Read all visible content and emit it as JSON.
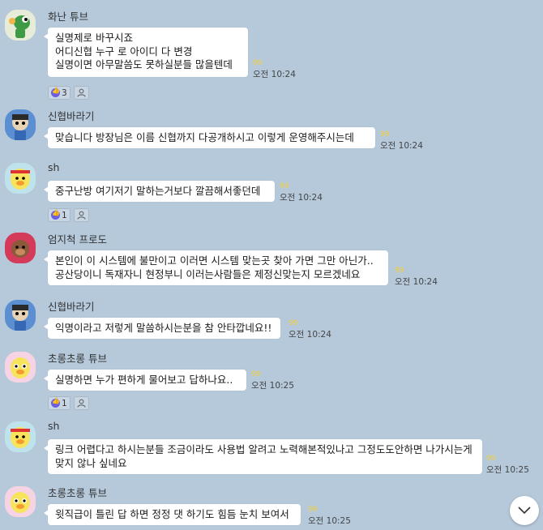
{
  "messages": [
    {
      "name": "화난 튜브",
      "lines": [
        "실명제로 바꾸시죠",
        "어디신협 누구 로 아이디 다 변경",
        "실명이면 아무말씀도 못하실분들 많을텐데"
      ],
      "unread": "99",
      "time": "오전 10:24",
      "reaction_count": "3",
      "avatar": "crocodile-avatar"
    },
    {
      "name": "신협바라기",
      "lines": [
        "맞습니다  방장님은 이름 신협까지 다공개하시고 이렇게 운영해주시는데"
      ],
      "unread": "99",
      "time": "오전 10:24",
      "avatar": "blue-character-avatar"
    },
    {
      "name": "sh",
      "lines": [
        "중구난방 여기저기 말하는거보다 깔끔해서좋던데"
      ],
      "unread": "99",
      "time": "오전 10:24",
      "reaction_count": "1",
      "avatar": "duck-headband-avatar"
    },
    {
      "name": "엄지척 프로도",
      "lines": [
        "본인이 이 시스템에 불만이고 이러면 시스템 맞는곳 찾아 가면 그만 아닌가..",
        "공산당이니 독재자니 현정부니 이러는사람들은 제정신맞는지 모르겠네요"
      ],
      "unread": "99",
      "time": "오전 10:24",
      "avatar": "frodo-dog-avatar"
    },
    {
      "name": "신협바라기",
      "lines": [
        "익명이라고 저렇게 말씀하시는분을 참 안타깝네요!!"
      ],
      "unread": "99",
      "time": "오전 10:24",
      "avatar": "blue-character-avatar"
    },
    {
      "name": "초롱초롱 튜브",
      "lines": [
        "실명하면 누가 편하게 물어보고 답하나요.."
      ],
      "unread": "99",
      "time": "오전 10:25",
      "reaction_count": "1",
      "avatar": "duck-pink-avatar"
    },
    {
      "name": "sh",
      "lines": [
        "링크 어렵다고 하시는분들 조금이라도 사용법 알려고 노력해본적있나고 그정도도안하면 나가시는게 맞지 않나 싶네요"
      ],
      "unread": "99",
      "time": "오전 10:25",
      "avatar": "duck-headband-avatar"
    },
    {
      "name": "초롱초롱 튜브",
      "lines": [
        "윗직급이 틀린 답 하면 정정 댓 하기도 힘듬 눈치 보여서"
      ],
      "unread": "99",
      "time": "오전 10:25",
      "avatar": "duck-pink-avatar"
    }
  ],
  "icons": {
    "reaction": "thumbs-up-icon",
    "people": "person-icon",
    "scroll": "chevron-down-icon"
  },
  "colors": {
    "background": "#b6c9db",
    "bubble": "#ffffff",
    "unread": "#f4cf38",
    "reaction": "#6d5de0"
  }
}
